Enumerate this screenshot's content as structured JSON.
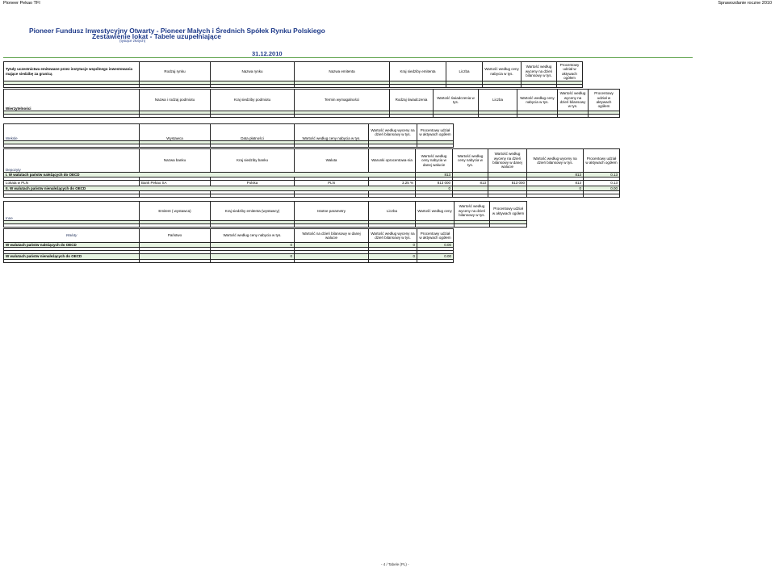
{
  "header": {
    "left": "Pioneer Pekao TFI",
    "right": "Sprawozdanie roczne 2010"
  },
  "title": {
    "line1": "Pioneer Fundusz Inwestycyjny Otwarty - Pioneer Małych i Średnich Spółek Rynku Polskiego",
    "line2": "Zestawienie lokat - Tabele uzupełniające",
    "line3": "(tysiące złotych)",
    "date": "31.12.2010"
  },
  "t1": {
    "section": "Tytuły uczestnictwa emitowane przez instytucje wspólnego inwestowania mające siedzibę za granicą",
    "cols": [
      "Rodzaj rynku",
      "Nazwa rynku",
      "Nazwa emitenta",
      "Kraj siedziby emitenta",
      "Liczba",
      "Wartość według ceny nabycia w tys.",
      "Wartość według wyceny na dzień bilansowy w tys.",
      "Procentowy udział w aktywach ogółem"
    ]
  },
  "t2": {
    "section": "Wierzytelności",
    "cols": [
      "Nazwa i rodzaj podmiotu",
      "Kraj siedziby podmiotu",
      "Termin wymagalności",
      "Rodzaj świadczenia",
      "Wartość świadczenia w tys.",
      "Liczba",
      "Wartość według ceny nabycia w tys.",
      "Wartość według wyceny na dzień bilansowy w tys.",
      "Procentowy udział w aktywach ogółem"
    ]
  },
  "t3": {
    "section": "Weksle",
    "cols": [
      "Wystawca",
      "Data płatności",
      "Wartość według ceny nabycia w tys.",
      "Wartość według wyceny na dzień bilansowy w tys.",
      "Procentowy udział w aktywach ogółem"
    ]
  },
  "t4": {
    "section": "Depozyty",
    "cols": [
      "Nazwa banku",
      "Kraj siedziby banku",
      "Waluta",
      "Warunki oprocentowa-nia",
      "Wartość według ceny nabycia w danej walucie",
      "Wartość według ceny nabycia w tys.",
      "Wartość według wyceny na dzień bilansowy w danej walucie",
      "Wartość według wyceny na dzień bilansowy w tys.",
      "Procentowy udział w aktywach ogółem"
    ],
    "row_oecd": {
      "label": "I. W walutach państw należących do OECD",
      "nabycia": "813",
      "wycena": "813",
      "udzial": "0.13"
    },
    "row_lokata": {
      "label": "Lokata w PLN",
      "bank": "Bank Pekao SA",
      "kraj": "Polska",
      "waluta": "PLN",
      "warunki": "3.25 %",
      "nab_wal": "813 000",
      "nab": "813",
      "wyc_wal": "813 000",
      "wyc": "813",
      "udzial": "0.13"
    },
    "row_non": {
      "label": "II. W walutach państw nienależących do OECD",
      "nabycia": "0",
      "wycena": "0",
      "udzial": "0.00"
    }
  },
  "t5": {
    "section": "Inne",
    "cols": [
      "Emitent ( wystawca)",
      "Kraj siedziby emitenta (wystawcy)",
      "Istotne parametry",
      "Liczba",
      "Wartość według ceny",
      "Wartość według wyceny na dzień bilansowy w tys.",
      "Procentowy udział w aktywach ogółem"
    ]
  },
  "t6": {
    "section": "Waluty",
    "cols": [
      "Państwo",
      "Wartość według ceny nabycia w tys.",
      "Wartość na dzień bilansowy w danej walucie",
      "Wartość według wyceny na dzień bilansowy w tys.",
      "Procentowy udział w aktywach ogółem"
    ],
    "row_oecd": {
      "label": "W walutach państw należących do OECD",
      "nab": "0",
      "wyc": "0",
      "udzial": "0.00"
    },
    "row_non": {
      "label": "W walutach państw nienależących do OECD",
      "nab": "0",
      "wyc": "0",
      "udzial": "0.00"
    }
  },
  "footer": "- 4 / Tabele (PL) -",
  "colors": {
    "title": "#1f3b8a",
    "accent_line": "#5da24b",
    "row_tint": "#e6f3e1"
  }
}
